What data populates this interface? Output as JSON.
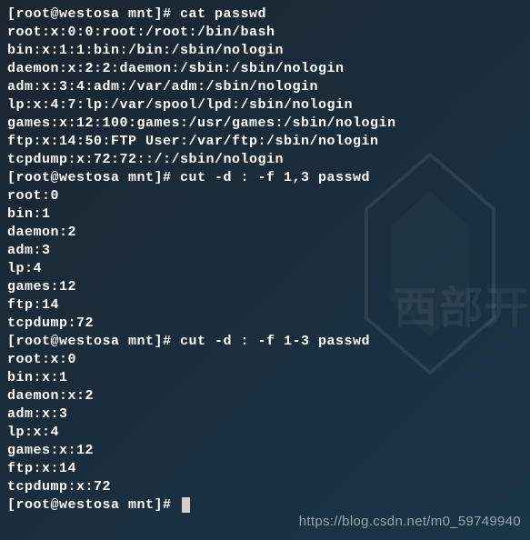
{
  "terminal": {
    "lines": [
      "[root@westosa mnt]# cat passwd",
      "root:x:0:0:root:/root:/bin/bash",
      "bin:x:1:1:bin:/bin:/sbin/nologin",
      "daemon:x:2:2:daemon:/sbin:/sbin/nologin",
      "adm:x:3:4:adm:/var/adm:/sbin/nologin",
      "lp:x:4:7:lp:/var/spool/lpd:/sbin/nologin",
      "games:x:12:100:games:/usr/games:/sbin/nologin",
      "ftp:x:14:50:FTP User:/var/ftp:/sbin/nologin",
      "tcpdump:x:72:72::/:/sbin/nologin",
      "[root@westosa mnt]# cut -d : -f 1,3 passwd",
      "root:0",
      "bin:1",
      "daemon:2",
      "adm:3",
      "lp:4",
      "games:12",
      "ftp:14",
      "tcpdump:72",
      "[root@westosa mnt]# cut -d : -f 1-3 passwd",
      "root:x:0",
      "bin:x:1",
      "daemon:x:2",
      "adm:x:3",
      "lp:x:4",
      "games:x:12",
      "ftp:x:14",
      "tcpdump:x:72"
    ],
    "prompt": "[root@westosa mnt]# "
  },
  "watermark": {
    "text_cn": "西部开",
    "url": "https://blog.csdn.net/m0_59749940"
  }
}
